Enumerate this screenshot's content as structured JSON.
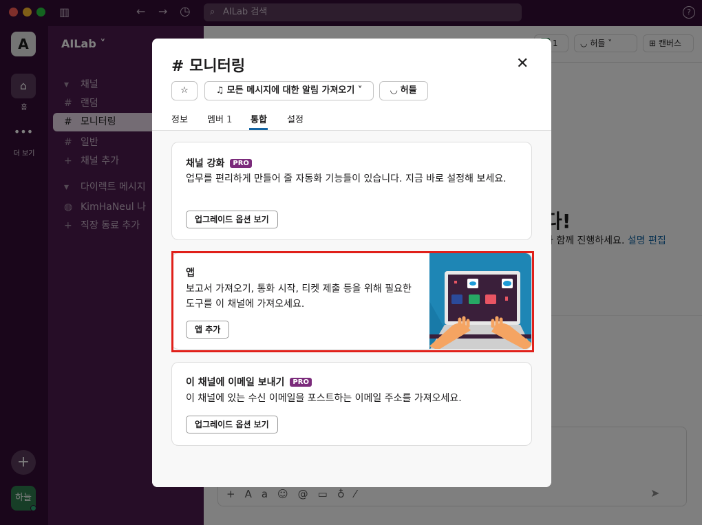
{
  "search": {
    "placeholder": "AILab 검색"
  },
  "rail": {
    "workspace_initial": "A",
    "home_label": "홈",
    "more_label": "더 보기",
    "avatar_text": "하늘"
  },
  "sidebar": {
    "workspace_name": "AILab",
    "channels_header": "채널",
    "channels": [
      {
        "label": "랜덤"
      },
      {
        "label": "모니터링"
      },
      {
        "label": "일반"
      }
    ],
    "add_channel": "채널 추가",
    "dm_header": "다이렉트 메시지",
    "dm_user": "KimHaNeul",
    "dm_you": "나",
    "add_coworker": "직장 동료 추가"
  },
  "header": {
    "member_count": "1",
    "huddle_label": "허들",
    "canvas_label": "캔버스"
  },
  "background": {
    "heading_fragment": "다!",
    "text_fragment": "과 함께 진행하세요.",
    "link_edit": "설명 편집"
  },
  "modal": {
    "channel_name": "모니터링",
    "notif_label": "모든 메시지에 대한 알림 가져오기",
    "huddle_label": "허들",
    "tabs": [
      "정보",
      "멤버",
      "통합",
      "설정"
    ],
    "member_count": "1",
    "cards": [
      {
        "title": "채널 강화",
        "badge": "PRO",
        "text": "업무를 편리하게 만들어 줄 자동화 기능들이 있습니다. 지금 바로 설정해 보세요.",
        "button": "업그레이드 옵션 보기"
      },
      {
        "title": "앱",
        "text": "보고서 가져오기, 통화 시작, 티켓 제출 등을 위해 필요한 도구를 이 채널에 가져오세요.",
        "button": "앱 추가"
      },
      {
        "title": "이 채널에 이메일 보내기",
        "badge": "PRO",
        "text": "이 채널에 있는 수신 이메일을 포스트하는 이메일 주소를 가져오세요.",
        "button": "업그레이드 옵션 보기"
      }
    ]
  },
  "colors": {
    "accent": "#1264a3",
    "highlight": "#e0201a",
    "pro": "#7b2b7b",
    "sidebar": "#4d1a4e"
  }
}
